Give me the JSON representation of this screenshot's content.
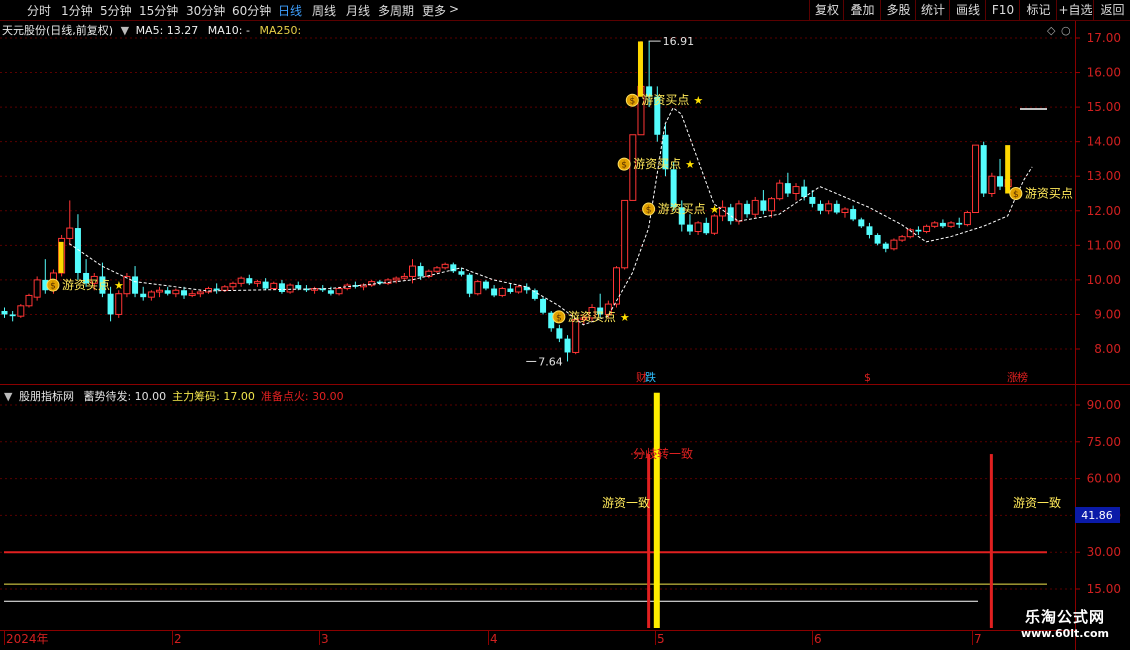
{
  "periods": [
    "分时",
    "1分钟",
    "5分钟",
    "15分钟",
    "30分钟",
    "60分钟",
    "日线",
    "周线",
    "月线",
    "多周期",
    "更多"
  ],
  "active_period": "日线",
  "tools": [
    "复权",
    "叠加",
    "多股",
    "统计",
    "画线",
    "F10",
    "标记",
    "+自选",
    "返回"
  ],
  "stock": {
    "name": "天元股份(日线,前复权)",
    "ma5_label": "MA5: 13.27",
    "ma10_label": "MA10: -",
    "ma250_label": "MA250:"
  },
  "indicator": {
    "name": "股朋指标网",
    "labels": [
      {
        "text": "蓄势待发: 10.00",
        "color": "#e0e0e0"
      },
      {
        "text": "主力筹码: 17.00",
        "color": "#f2e64c"
      },
      {
        "text": "准备点火: 30.00",
        "color": "#e02020"
      }
    ],
    "current_value": "41.86"
  },
  "price_axis": [
    "17.00",
    "16.00",
    "15.00",
    "14.00",
    "13.00",
    "12.00",
    "11.00",
    "10.00",
    "9.00",
    "8.00"
  ],
  "indicator_axis": [
    "90.00",
    "75.00",
    "60.00",
    "45.00",
    "30.00",
    "15.00"
  ],
  "months": [
    "2024年",
    "2",
    "3",
    "4",
    "5",
    "6",
    "7"
  ],
  "annotations": {
    "high": "16.91",
    "low": "7.64",
    "buy_label": "游资买点",
    "star": "★",
    "diverge": "分歧转一致",
    "consensus": "游资一致",
    "money_glyph": "$"
  },
  "events": [
    "财",
    "跌",
    "$",
    "涨",
    "榜"
  ],
  "watermark": {
    "line1": "乐淘公式网",
    "line2": "www.60lt.com"
  },
  "chart_data": {
    "type": "candlestick",
    "y_range": [
      7.5,
      17.3
    ],
    "series": [
      {
        "name": "K",
        "ohlc": [
          [
            9.1,
            9.2,
            8.9,
            9.0
          ],
          [
            9.0,
            9.1,
            8.8,
            8.95
          ],
          [
            8.95,
            9.3,
            8.9,
            9.25
          ],
          [
            9.25,
            9.6,
            9.2,
            9.55
          ],
          [
            9.5,
            10.1,
            9.4,
            10.0
          ],
          [
            10.0,
            10.6,
            9.6,
            9.7
          ],
          [
            9.7,
            10.3,
            9.6,
            10.2
          ],
          [
            10.2,
            11.3,
            10.1,
            11.2
          ],
          [
            11.2,
            12.3,
            11.0,
            11.5
          ],
          [
            11.5,
            11.9,
            10.0,
            10.2
          ],
          [
            10.2,
            10.6,
            9.8,
            9.9
          ],
          [
            9.9,
            10.2,
            9.7,
            10.1
          ],
          [
            10.1,
            10.5,
            9.5,
            9.6
          ],
          [
            9.6,
            9.8,
            8.8,
            9.0
          ],
          [
            9.0,
            9.7,
            8.9,
            9.6
          ],
          [
            9.6,
            10.2,
            9.5,
            10.1
          ],
          [
            10.1,
            10.4,
            9.5,
            9.6
          ],
          [
            9.6,
            9.8,
            9.4,
            9.5
          ],
          [
            9.5,
            9.7,
            9.4,
            9.65
          ],
          [
            9.65,
            9.8,
            9.5,
            9.7
          ],
          [
            9.7,
            9.8,
            9.55,
            9.6
          ],
          [
            9.6,
            9.75,
            9.5,
            9.7
          ],
          [
            9.7,
            9.8,
            9.45,
            9.55
          ],
          [
            9.55,
            9.7,
            9.5,
            9.6
          ],
          [
            9.6,
            9.7,
            9.5,
            9.65
          ],
          [
            9.65,
            9.8,
            9.6,
            9.75
          ],
          [
            9.75,
            9.9,
            9.6,
            9.7
          ],
          [
            9.7,
            9.85,
            9.65,
            9.8
          ],
          [
            9.8,
            9.95,
            9.7,
            9.9
          ],
          [
            9.9,
            10.1,
            9.8,
            10.05
          ],
          [
            10.05,
            10.15,
            9.85,
            9.9
          ],
          [
            9.9,
            10.0,
            9.8,
            9.95
          ],
          [
            9.95,
            10.05,
            9.7,
            9.75
          ],
          [
            9.75,
            9.95,
            9.7,
            9.9
          ],
          [
            9.9,
            10.0,
            9.6,
            9.65
          ],
          [
            9.65,
            9.9,
            9.6,
            9.85
          ],
          [
            9.85,
            9.95,
            9.7,
            9.75
          ],
          [
            9.75,
            9.85,
            9.65,
            9.7
          ],
          [
            9.7,
            9.8,
            9.6,
            9.75
          ],
          [
            9.75,
            9.85,
            9.65,
            9.7
          ],
          [
            9.7,
            9.8,
            9.55,
            9.6
          ],
          [
            9.6,
            9.8,
            9.55,
            9.75
          ],
          [
            9.75,
            9.9,
            9.7,
            9.85
          ],
          [
            9.85,
            9.95,
            9.75,
            9.8
          ],
          [
            9.8,
            9.9,
            9.7,
            9.85
          ],
          [
            9.85,
            10.0,
            9.8,
            9.95
          ],
          [
            9.95,
            10.0,
            9.85,
            9.9
          ],
          [
            9.9,
            10.05,
            9.85,
            10.0
          ],
          [
            10.0,
            10.1,
            9.9,
            10.05
          ],
          [
            10.05,
            10.2,
            10.0,
            10.1
          ],
          [
            10.1,
            10.6,
            9.9,
            10.4
          ],
          [
            10.4,
            10.5,
            10.0,
            10.1
          ],
          [
            10.1,
            10.3,
            10.05,
            10.25
          ],
          [
            10.25,
            10.4,
            10.2,
            10.35
          ],
          [
            10.35,
            10.5,
            10.3,
            10.45
          ],
          [
            10.45,
            10.5,
            10.2,
            10.25
          ],
          [
            10.25,
            10.35,
            10.1,
            10.15
          ],
          [
            10.15,
            10.2,
            9.5,
            9.6
          ],
          [
            9.6,
            10.0,
            9.55,
            9.95
          ],
          [
            9.95,
            10.0,
            9.7,
            9.75
          ],
          [
            9.75,
            9.85,
            9.5,
            9.55
          ],
          [
            9.55,
            9.8,
            9.5,
            9.75
          ],
          [
            9.75,
            9.9,
            9.6,
            9.65
          ],
          [
            9.65,
            9.85,
            9.6,
            9.8
          ],
          [
            9.8,
            9.9,
            9.6,
            9.7
          ],
          [
            9.7,
            9.75,
            9.4,
            9.45
          ],
          [
            9.45,
            9.5,
            9.0,
            9.05
          ],
          [
            9.05,
            9.1,
            8.5,
            8.6
          ],
          [
            8.6,
            8.7,
            8.2,
            8.3
          ],
          [
            8.3,
            8.4,
            7.64,
            7.9
          ],
          [
            7.9,
            8.9,
            7.85,
            8.85
          ],
          [
            8.85,
            9.0,
            8.7,
            8.9
          ],
          [
            8.9,
            9.3,
            8.8,
            9.2
          ],
          [
            9.2,
            9.6,
            8.9,
            9.0
          ],
          [
            9.0,
            9.4,
            8.9,
            9.3
          ],
          [
            9.3,
            10.4,
            9.2,
            10.35
          ],
          [
            10.35,
            12.3,
            10.3,
            12.3
          ],
          [
            12.3,
            14.2,
            12.3,
            14.2
          ],
          [
            14.2,
            16.91,
            14.2,
            15.6
          ],
          [
            15.6,
            16.91,
            15.0,
            15.3
          ],
          [
            15.3,
            15.6,
            14.0,
            14.2
          ],
          [
            14.2,
            14.5,
            13.0,
            13.2
          ],
          [
            13.2,
            13.4,
            12.0,
            12.1
          ],
          [
            12.1,
            12.3,
            11.4,
            11.6
          ],
          [
            11.6,
            11.9,
            11.3,
            11.4
          ],
          [
            11.4,
            11.7,
            11.3,
            11.65
          ],
          [
            11.65,
            11.8,
            11.3,
            11.35
          ],
          [
            11.35,
            11.9,
            11.3,
            11.85
          ],
          [
            11.85,
            12.3,
            11.7,
            12.1
          ],
          [
            12.1,
            12.2,
            11.6,
            11.7
          ],
          [
            11.7,
            12.3,
            11.6,
            12.2
          ],
          [
            12.2,
            12.3,
            11.8,
            11.9
          ],
          [
            11.9,
            12.4,
            11.8,
            12.3
          ],
          [
            12.3,
            12.6,
            11.9,
            12.0
          ],
          [
            12.0,
            12.4,
            11.8,
            12.35
          ],
          [
            12.35,
            12.9,
            12.3,
            12.8
          ],
          [
            12.8,
            13.1,
            12.4,
            12.5
          ],
          [
            12.5,
            12.8,
            12.3,
            12.7
          ],
          [
            12.7,
            12.9,
            12.3,
            12.4
          ],
          [
            12.4,
            12.6,
            12.1,
            12.2
          ],
          [
            12.2,
            12.3,
            11.9,
            12.0
          ],
          [
            12.0,
            12.3,
            11.9,
            12.2
          ],
          [
            12.2,
            12.3,
            11.9,
            11.95
          ],
          [
            11.95,
            12.1,
            11.8,
            12.05
          ],
          [
            12.05,
            12.15,
            11.7,
            11.75
          ],
          [
            11.75,
            11.8,
            11.5,
            11.55
          ],
          [
            11.55,
            11.65,
            11.2,
            11.3
          ],
          [
            11.3,
            11.35,
            11.0,
            11.05
          ],
          [
            11.05,
            11.1,
            10.8,
            10.9
          ],
          [
            10.9,
            11.2,
            10.85,
            11.15
          ],
          [
            11.15,
            11.3,
            11.1,
            11.25
          ],
          [
            11.25,
            11.5,
            11.2,
            11.45
          ],
          [
            11.45,
            11.55,
            11.3,
            11.4
          ],
          [
            11.4,
            11.6,
            11.35,
            11.55
          ],
          [
            11.55,
            11.7,
            11.5,
            11.65
          ],
          [
            11.65,
            11.75,
            11.5,
            11.55
          ],
          [
            11.55,
            11.7,
            11.5,
            11.65
          ],
          [
            11.65,
            11.8,
            11.5,
            11.6
          ],
          [
            11.6,
            12.0,
            11.55,
            11.95
          ],
          [
            11.95,
            13.9,
            11.95,
            13.9
          ],
          [
            13.9,
            14.0,
            12.4,
            12.5
          ],
          [
            12.5,
            13.1,
            12.4,
            13.0
          ],
          [
            13.0,
            13.5,
            12.6,
            12.7
          ],
          [
            12.7,
            13.3,
            12.6,
            12.9
          ]
        ]
      },
      {
        "name": "MA5",
        "points": [
          [
            8,
            11.05
          ],
          [
            12,
            10.4
          ],
          [
            16,
            9.95
          ],
          [
            25,
            9.68
          ],
          [
            40,
            9.75
          ],
          [
            50,
            10.0
          ],
          [
            56,
            10.35
          ],
          [
            60,
            10.0
          ],
          [
            64,
            9.8
          ],
          [
            68,
            9.25
          ],
          [
            71,
            8.7
          ],
          [
            74,
            8.95
          ],
          [
            77,
            10.2
          ],
          [
            79,
            11.5
          ],
          [
            81,
            14.5
          ],
          [
            82,
            14.98
          ],
          [
            83,
            14.8
          ],
          [
            85,
            13.5
          ],
          [
            87,
            12.2
          ],
          [
            90,
            11.7
          ],
          [
            95,
            11.9
          ],
          [
            100,
            12.7
          ],
          [
            102,
            12.5
          ],
          [
            106,
            12.1
          ],
          [
            110,
            11.6
          ],
          [
            113,
            11.1
          ],
          [
            116,
            11.25
          ],
          [
            120,
            11.55
          ],
          [
            123,
            11.85
          ],
          [
            124,
            12.4
          ],
          [
            125,
            12.9
          ],
          [
            126,
            13.27
          ]
        ]
      }
    ],
    "indicator_y_range": [
      10,
      95
    ],
    "indicator": {
      "levels": [
        {
          "name": "蓄势待发",
          "value": 10
        },
        {
          "name": "主力筹码",
          "value": 17
        },
        {
          "name": "准备点火",
          "value": 30
        }
      ],
      "spikes": [
        {
          "i": 79,
          "top": 70
        },
        {
          "i": 80,
          "top": 95
        },
        {
          "i": 121,
          "top": 70
        }
      ]
    }
  }
}
